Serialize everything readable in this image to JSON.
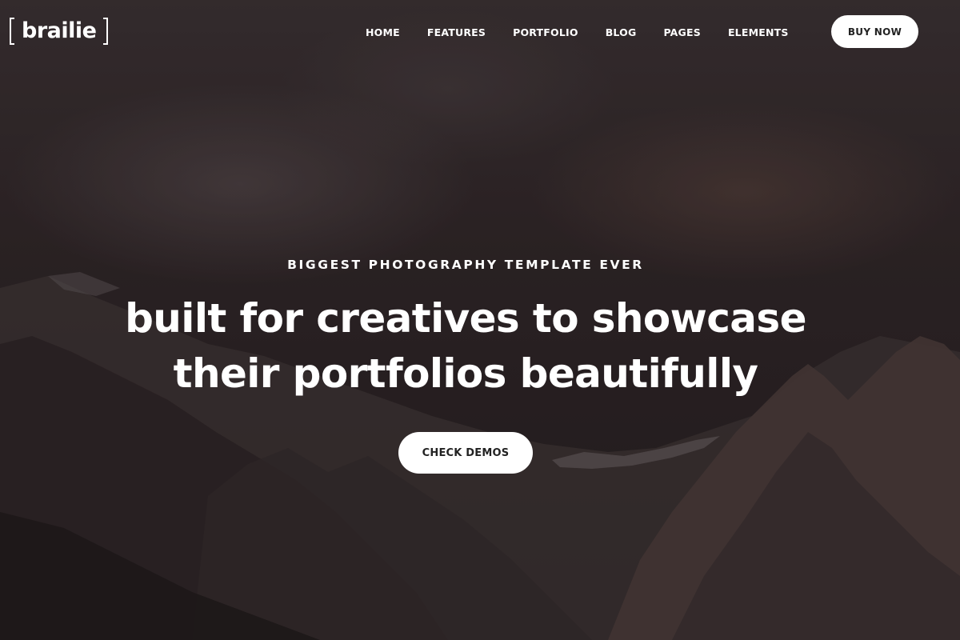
{
  "brand": {
    "name": "brailie"
  },
  "nav": {
    "items": [
      {
        "label": "HOME"
      },
      {
        "label": "FEATURES"
      },
      {
        "label": "PORTFOLIO"
      },
      {
        "label": "BLOG"
      },
      {
        "label": "PAGES"
      },
      {
        "label": "ELEMENTS"
      }
    ],
    "cta_label": "BUY NOW"
  },
  "hero": {
    "kicker": "BIGGEST PHOTOGRAPHY TEMPLATE EVER",
    "headline_line1": "built for creatives to showcase",
    "headline_line2": "their portfolios beautifully",
    "cta_label": "CHECK DEMOS",
    "background": "dark-mountain-landscape-photo"
  },
  "colors": {
    "text": "#ffffff",
    "button_bg": "#ffffff",
    "button_text": "#222222",
    "background_dark": "#2a2224"
  }
}
